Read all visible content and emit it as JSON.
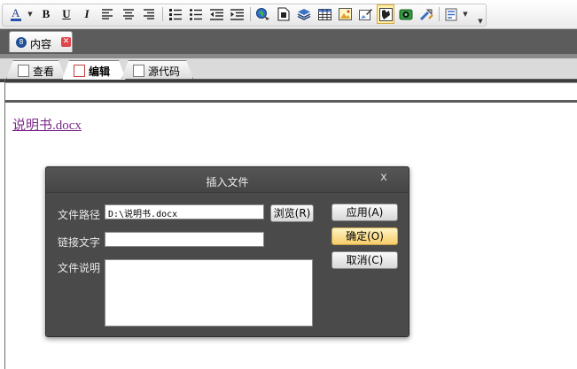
{
  "toolbar": {
    "buttons": [
      {
        "name": "font-color-icon",
        "glyph": "A"
      },
      {
        "name": "bold-icon",
        "glyph": "B"
      },
      {
        "name": "underline-icon",
        "glyph": "U"
      },
      {
        "name": "italic-icon",
        "glyph": "I"
      },
      {
        "name": "align-left-icon",
        "glyph": ""
      },
      {
        "name": "align-center-icon",
        "glyph": ""
      },
      {
        "name": "align-right-icon",
        "glyph": ""
      },
      {
        "name": "ordered-list-icon",
        "glyph": ""
      },
      {
        "name": "unordered-list-icon",
        "glyph": ""
      },
      {
        "name": "outdent-icon",
        "glyph": ""
      },
      {
        "name": "indent-icon",
        "glyph": ""
      },
      {
        "name": "insert-link-icon",
        "glyph": ""
      },
      {
        "name": "insert-file-icon",
        "glyph": ""
      },
      {
        "name": "layers-icon",
        "glyph": ""
      },
      {
        "name": "insert-table-icon",
        "glyph": ""
      },
      {
        "name": "insert-image-icon",
        "glyph": ""
      },
      {
        "name": "edit-image-icon",
        "glyph": ""
      },
      {
        "name": "insert-media-icon",
        "glyph": ""
      },
      {
        "name": "insert-video-icon",
        "glyph": ""
      },
      {
        "name": "tools-icon",
        "glyph": ""
      },
      {
        "name": "format-icon",
        "glyph": ""
      }
    ],
    "accent_color": "#f5c542"
  },
  "document_tab": {
    "number": "8",
    "label": "内容",
    "close_color": "#e0454a"
  },
  "mode_tabs": [
    {
      "label": "查看",
      "active": false
    },
    {
      "label": "编辑",
      "active": true
    },
    {
      "label": "源代码",
      "active": false
    }
  ],
  "editor": {
    "link_text": "说明书.docx",
    "link_color": "#7b2a8a"
  },
  "dialog": {
    "title": "插入文件",
    "close_glyph": "x",
    "fields": {
      "path_label": "文件路径",
      "path_value": "D:\\说明书.docx",
      "link_text_label": "链接文字",
      "link_text_value": "",
      "description_label": "文件说明",
      "description_value": ""
    },
    "buttons": {
      "browse": "浏览(R)",
      "apply": "应用(A)",
      "ok": "确定(O)",
      "cancel": "取消(C)"
    }
  }
}
